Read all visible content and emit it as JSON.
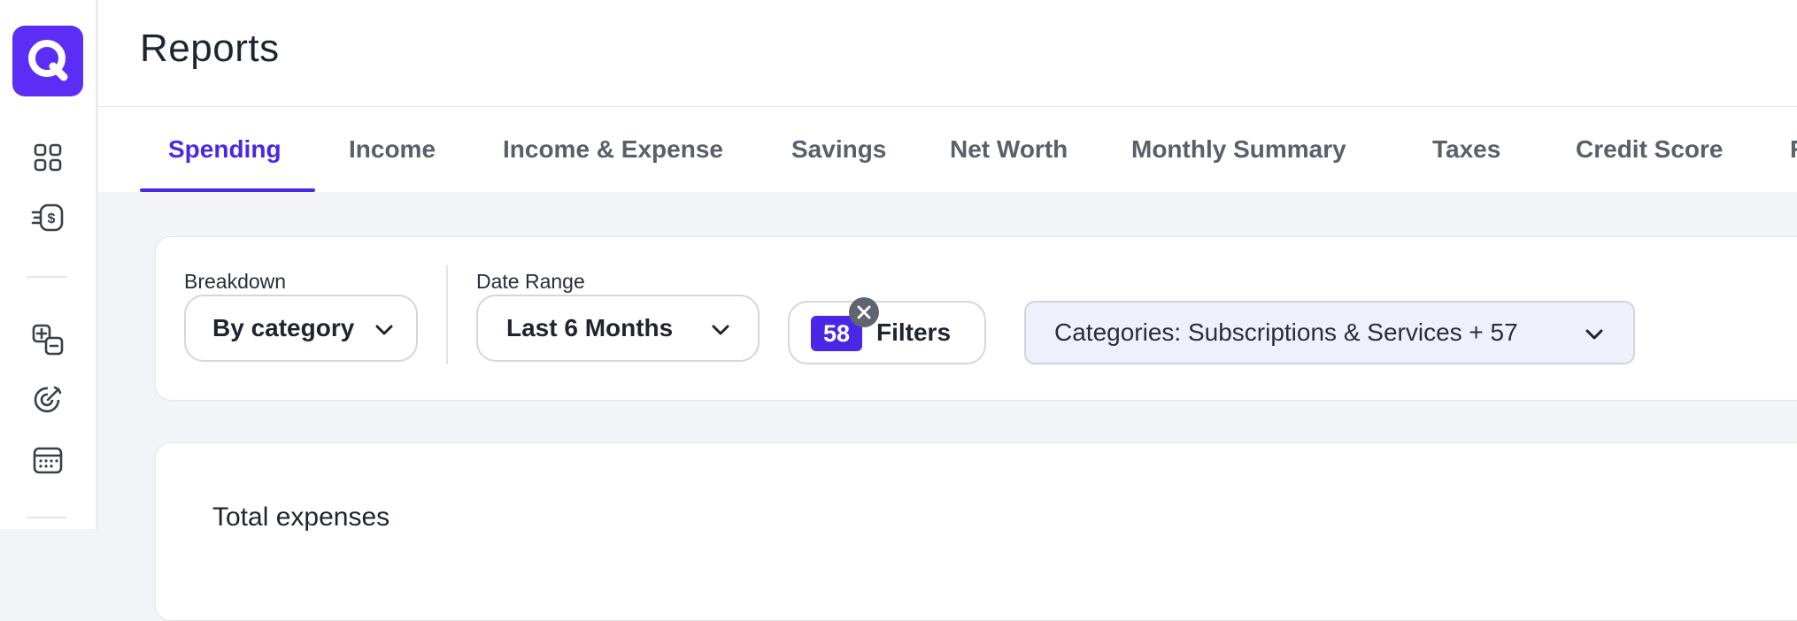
{
  "header": {
    "title": "Reports"
  },
  "sidebar": {
    "icons": [
      "logo-icon",
      "dashboard-icon",
      "money-list-icon",
      "budget-add-remove-icon",
      "goals-target-icon",
      "calendar-icon"
    ]
  },
  "tabs": [
    {
      "label": "Spending",
      "active": true
    },
    {
      "label": "Income"
    },
    {
      "label": "Income & Expense"
    },
    {
      "label": "Savings"
    },
    {
      "label": "Net Worth"
    },
    {
      "label": "Monthly Summary"
    },
    {
      "label": "Taxes"
    },
    {
      "label": "Credit Score"
    },
    {
      "label": "R"
    }
  ],
  "filters": {
    "breakdown_label": "Breakdown",
    "breakdown_value": "By category",
    "date_range_label": "Date Range",
    "date_range_value": "Last 6 Months",
    "filters_count": "58",
    "filters_label": "Filters",
    "categories_value": "Categories: Subscriptions & Services + 57"
  },
  "summary": {
    "total_label": "Total expenses"
  },
  "colors": {
    "accent": "#4a27e6",
    "logo": "#5b2df5",
    "chip_bg": "#eff0fb"
  }
}
